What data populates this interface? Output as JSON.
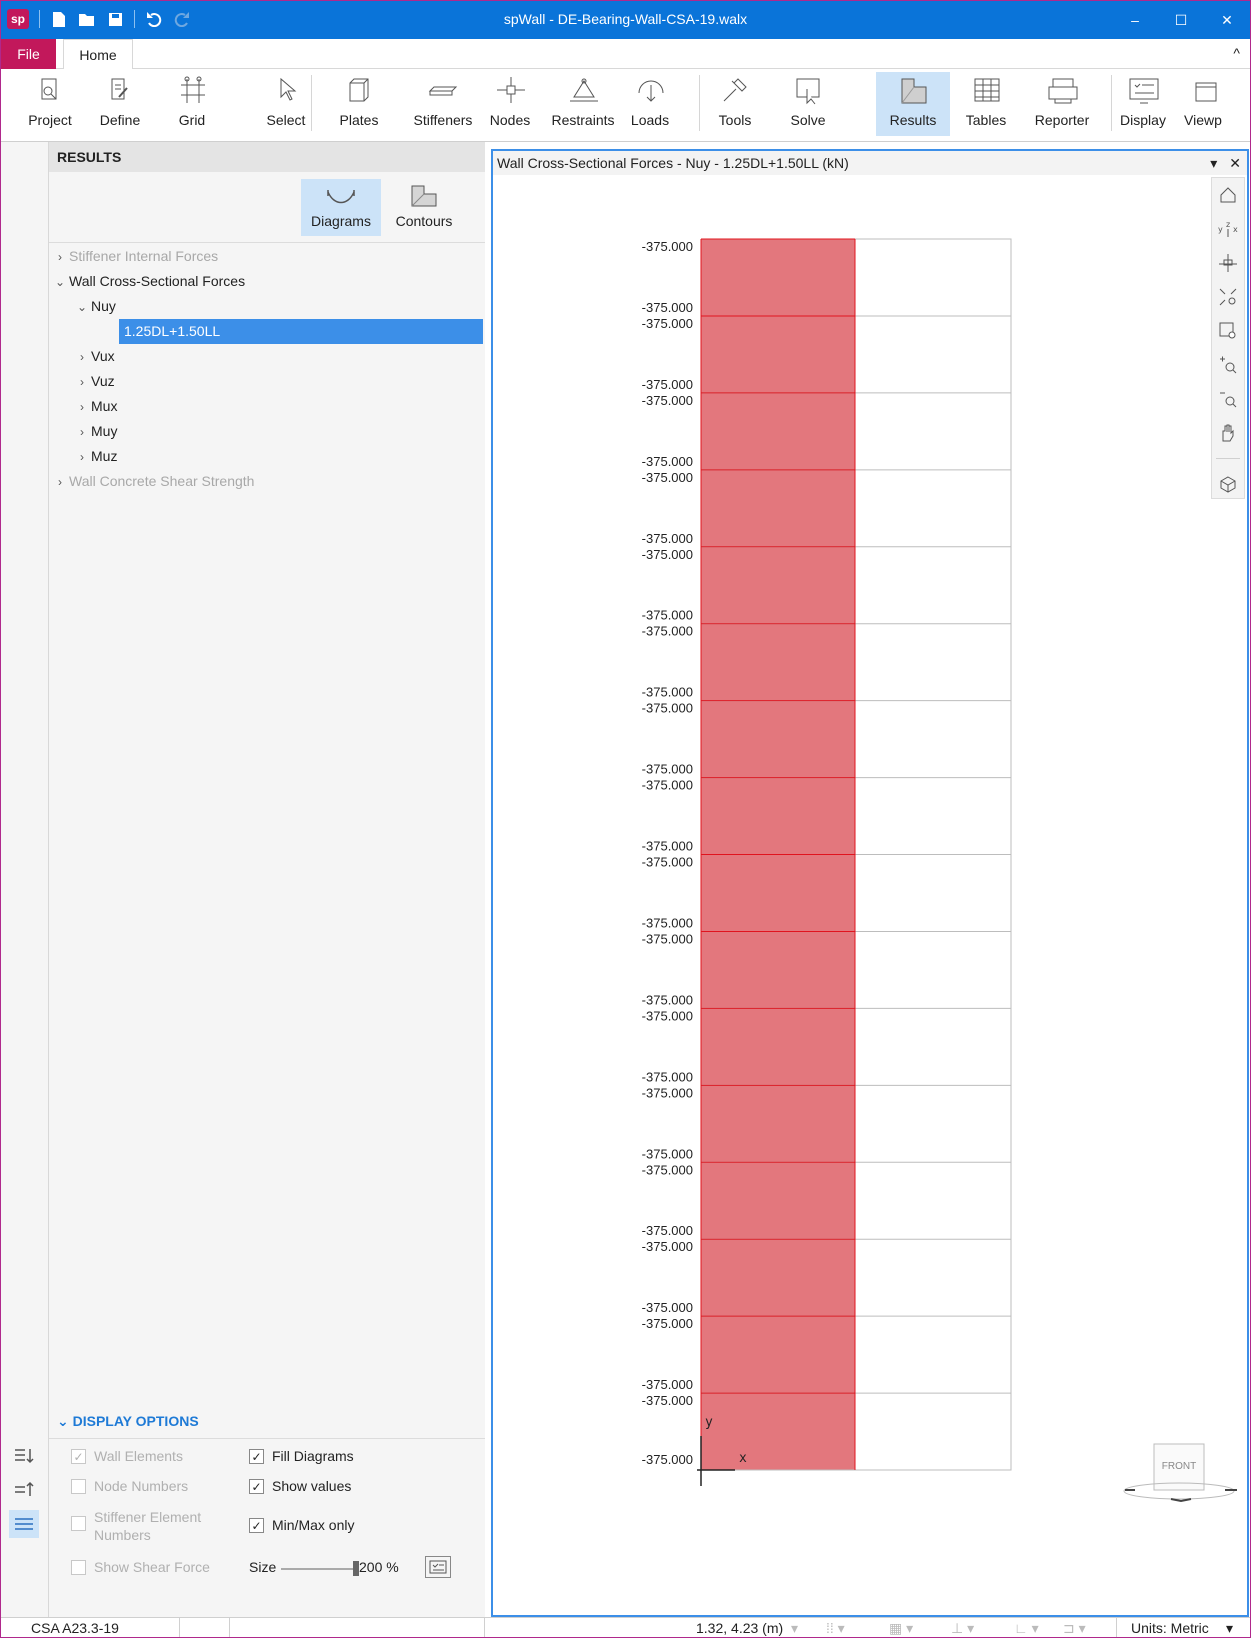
{
  "titlebar": {
    "logo": "sp",
    "title": "spWall - DE-Bearing-Wall-CSA-19.walx",
    "minimize": "–",
    "maximize": "☐",
    "close": "✕"
  },
  "tabs": {
    "file": "File",
    "home": "Home",
    "collapse": "^"
  },
  "ribbon": [
    {
      "label": "Project",
      "icon": "project-icon"
    },
    {
      "label": "Define",
      "icon": "define-icon"
    },
    {
      "label": "Grid",
      "icon": "grid-icon"
    },
    {
      "label": "Select",
      "icon": "select-cursor-icon"
    },
    {
      "label": "Plates",
      "icon": "plates-icon"
    },
    {
      "label": "Stiffeners",
      "icon": "stiffeners-icon"
    },
    {
      "label": "Nodes",
      "icon": "nodes-icon"
    },
    {
      "label": "Restraints",
      "icon": "restraints-icon"
    },
    {
      "label": "Loads",
      "icon": "loads-icon"
    },
    {
      "label": "Tools",
      "icon": "tools-icon"
    },
    {
      "label": "Solve",
      "icon": "solve-icon"
    },
    {
      "label": "Results",
      "icon": "results-icon",
      "active": true
    },
    {
      "label": "Tables",
      "icon": "tables-icon"
    },
    {
      "label": "Reporter",
      "icon": "reporter-icon"
    },
    {
      "label": "Display",
      "icon": "display-icon"
    },
    {
      "label": "Viewp",
      "icon": "viewport-icon"
    }
  ],
  "panel": {
    "title": "RESULTS",
    "view_toggle": {
      "diagrams": "Diagrams",
      "contours": "Contours",
      "selected": "Diagrams"
    },
    "tree": [
      {
        "label": "Stiffener Internal Forces",
        "level": 0,
        "disabled": true,
        "expanded": false
      },
      {
        "label": "Wall Cross-Sectional Forces",
        "level": 0,
        "expanded": true
      },
      {
        "label": "Nuy",
        "level": 1,
        "expanded": true
      },
      {
        "label": "1.25DL+1.50LL",
        "level": 2,
        "selected": true
      },
      {
        "label": "Vux",
        "level": 1
      },
      {
        "label": "Vuz",
        "level": 1
      },
      {
        "label": "Mux",
        "level": 1
      },
      {
        "label": "Muy",
        "level": 1
      },
      {
        "label": "Muz",
        "level": 1
      },
      {
        "label": "Wall Concrete Shear Strength",
        "level": 0,
        "disabled": true
      }
    ],
    "display_options": {
      "title": "DISPLAY OPTIONS",
      "wall_elements": "Wall Elements",
      "node_numbers": "Node Numbers",
      "stiffener_element_numbers": "Stiffener Element Numbers",
      "show_shear_force": "Show Shear Force",
      "fill_diagrams": "Fill Diagrams",
      "show_values": "Show values",
      "min_max_only": "Min/Max only",
      "size_label": "Size",
      "size_value": "200 %",
      "size_level": 1.0
    }
  },
  "viewport": {
    "title": "Wall Cross-Sectional Forces - Nuy - 1.25DL+1.50LL (kN)",
    "menu": "▾",
    "close": "✕",
    "values": [
      "-375.000",
      "-375.000",
      "-375.000",
      "-375.000",
      "-375.000",
      "-375.000",
      "-375.000",
      "-375.000",
      "-375.000",
      "-375.000",
      "-375.000",
      "-375.000",
      "-375.000",
      "-375.000",
      "-375.000",
      "-375.000",
      "-375.000",
      "-375.000",
      "-375.000",
      "-375.000",
      "-375.000",
      "-375.000",
      "-375.000",
      "-375.000",
      "-375.000",
      "-375.000",
      "-375.000",
      "-375.000",
      "-375.000",
      "-375.000",
      "-375.000",
      "-375.000"
    ],
    "axis_x": "x",
    "axis_y": "y",
    "view_cube": "FRONT",
    "colors": {
      "fill": "#e3777d",
      "line": "#e0141e",
      "grid": "#bdbdbd"
    }
  },
  "statusbar": {
    "code": "CSA A23.3-19",
    "coords": "1.32, 4.23 (m)",
    "units": "Units: Metric"
  }
}
